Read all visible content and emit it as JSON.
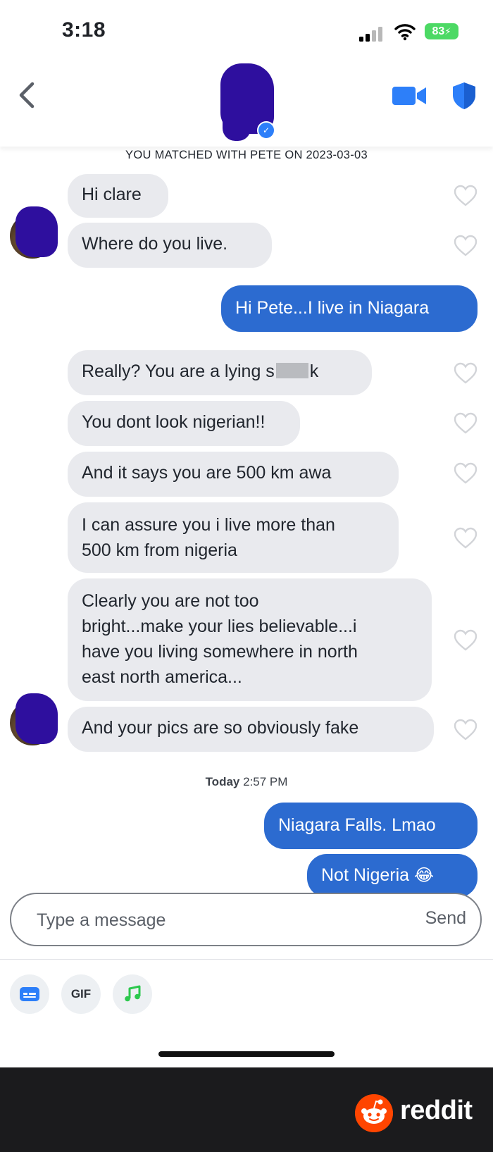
{
  "status_bar": {
    "time": "3:18",
    "battery": "83"
  },
  "header": {
    "back_icon": "chevron-left-icon",
    "video_icon": "video-camera-icon",
    "safety_icon": "shield-icon",
    "accent_color": "#2d7ff9"
  },
  "match_banner": "YOU MATCHED WITH PETE ON 2023-03-03",
  "messages": [
    {
      "from": "them",
      "lines": [
        "Hi clare"
      ]
    },
    {
      "from": "them",
      "lines": [
        "Where do you live."
      ]
    },
    {
      "from": "me",
      "lines": [
        "Hi Pete...I live in Niagara"
      ]
    },
    {
      "from": "them",
      "lines": [
        "Really? You are a lying s",
        "k"
      ]
    },
    {
      "from": "them",
      "lines": [
        "You dont look nigerian!!"
      ]
    },
    {
      "from": "them",
      "lines": [
        "And it says you are 500 km awa"
      ]
    },
    {
      "from": "them",
      "lines": [
        "I can assure you i live more than",
        "500 km from nigeria"
      ]
    },
    {
      "from": "them",
      "lines": [
        "Clearly you are not too",
        "bright...make your lies believable...i",
        "have you living somewhere in north",
        "east north america..."
      ]
    },
    {
      "from": "them",
      "lines": [
        "And your pics are so obviously fake"
      ]
    },
    {
      "from": "me",
      "lines": [
        "Niagara Falls. Lmao"
      ]
    },
    {
      "from": "me",
      "lines": [
        "Not Nigeria",
        "😂"
      ]
    }
  ],
  "timestamp": {
    "day": "Today",
    "time": "2:57 PM"
  },
  "composer": {
    "placeholder": "Type a message",
    "send_label": "Send"
  },
  "toolbar": {
    "gif_label": "GIF",
    "sticker_icon": "card-icon",
    "music_icon": "music-note-icon"
  },
  "footer": {
    "brand": "reddit",
    "brand_color": "#ff4500"
  }
}
